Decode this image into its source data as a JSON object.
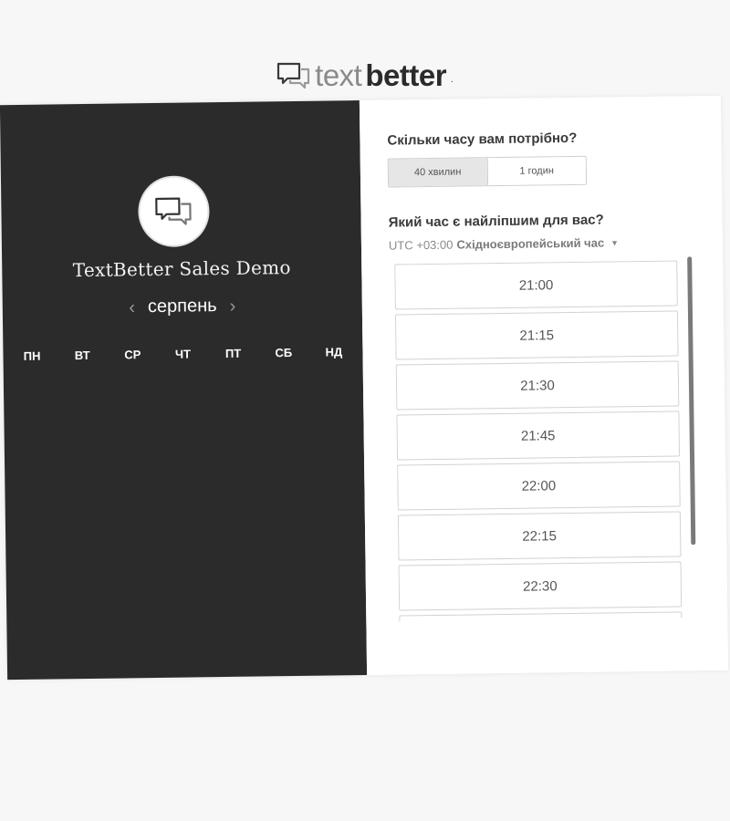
{
  "brand": {
    "logo_text_light": "text",
    "logo_text_bold": "better",
    "logo_suffix": "."
  },
  "booking": {
    "event_name": "TextBetter Sales Demo",
    "calendar": {
      "month": "серпень",
      "prev_icon": "chevron-left-icon",
      "next_icon": "chevron-right-icon",
      "weekdays": [
        "ПН",
        "ВТ",
        "СР",
        "ЧТ",
        "ПТ",
        "СБ",
        "НД"
      ]
    },
    "duration": {
      "title": "Скільки часу вам потрібно?",
      "options": [
        "40 хвилин",
        "1 годин"
      ],
      "selected": "40 хвилин"
    },
    "time": {
      "title": "Який час є найліпшим для вас?",
      "timezone_offset": "UTC +03:00",
      "timezone_name": "Східноєвропейський час",
      "slots": [
        "21:00",
        "21:15",
        "21:30",
        "21:45",
        "22:00",
        "22:15",
        "22:30",
        ""
      ]
    }
  },
  "colors": {
    "left_panel": "#2b2b2b",
    "right_panel": "#ffffff",
    "page_background": "#f7f7f7",
    "selected_duration": "#e6e6e6"
  }
}
